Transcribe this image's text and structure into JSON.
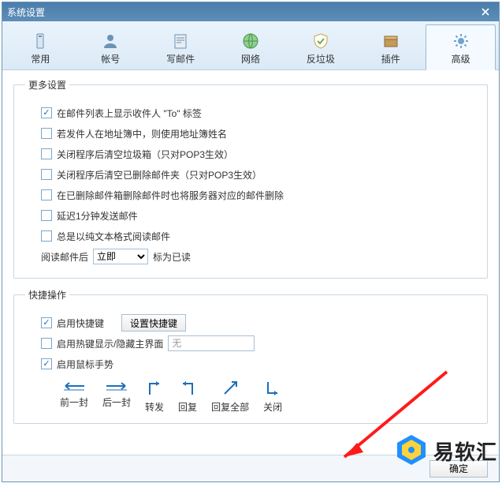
{
  "window": {
    "title": "系统设置"
  },
  "tabs": [
    {
      "label": "常用"
    },
    {
      "label": "帐号"
    },
    {
      "label": "写邮件"
    },
    {
      "label": "网络"
    },
    {
      "label": "反垃圾"
    },
    {
      "label": "插件"
    },
    {
      "label": "高级"
    }
  ],
  "more": {
    "legend": "更多设置",
    "items": {
      "show_to": {
        "label": "在邮件列表上显示收件人 \"To\" 标签"
      },
      "use_ab_name": {
        "label": "若发件人在地址簿中，则使用地址簿姓名"
      },
      "empty_trash": {
        "label": "关闭程序后清空垃圾箱（只对POP3生效）"
      },
      "empty_deleted": {
        "label": "关闭程序后清空已删除邮件夹（只对POP3生效）"
      },
      "del_server": {
        "label": "在已删除邮件箱删除邮件时也将服务器对应的邮件删除"
      },
      "delay_send": {
        "label": "延迟1分钟发送邮件"
      },
      "plain_text": {
        "label": "总是以纯文本格式阅读邮件"
      }
    },
    "mark_read": {
      "prefix": "阅读邮件后",
      "suffix": "标为已读",
      "selected": "立即"
    }
  },
  "shortcuts": {
    "legend": "快捷操作",
    "enable_shortcut": {
      "label": "启用快捷键"
    },
    "set_button": "设置快捷键",
    "hotkey_toggle": {
      "label": "启用热键显示/隐藏主界面",
      "placeholder": "无"
    },
    "enable_gesture": {
      "label": "启用鼠标手势"
    },
    "gestures": {
      "prev": "前一封",
      "next": "后一封",
      "forward": "转发",
      "reply": "回复",
      "reply_all": "回复全部",
      "close": "关闭"
    }
  },
  "footer": {
    "ok": "确定"
  },
  "branding": {
    "text": "易软汇"
  }
}
